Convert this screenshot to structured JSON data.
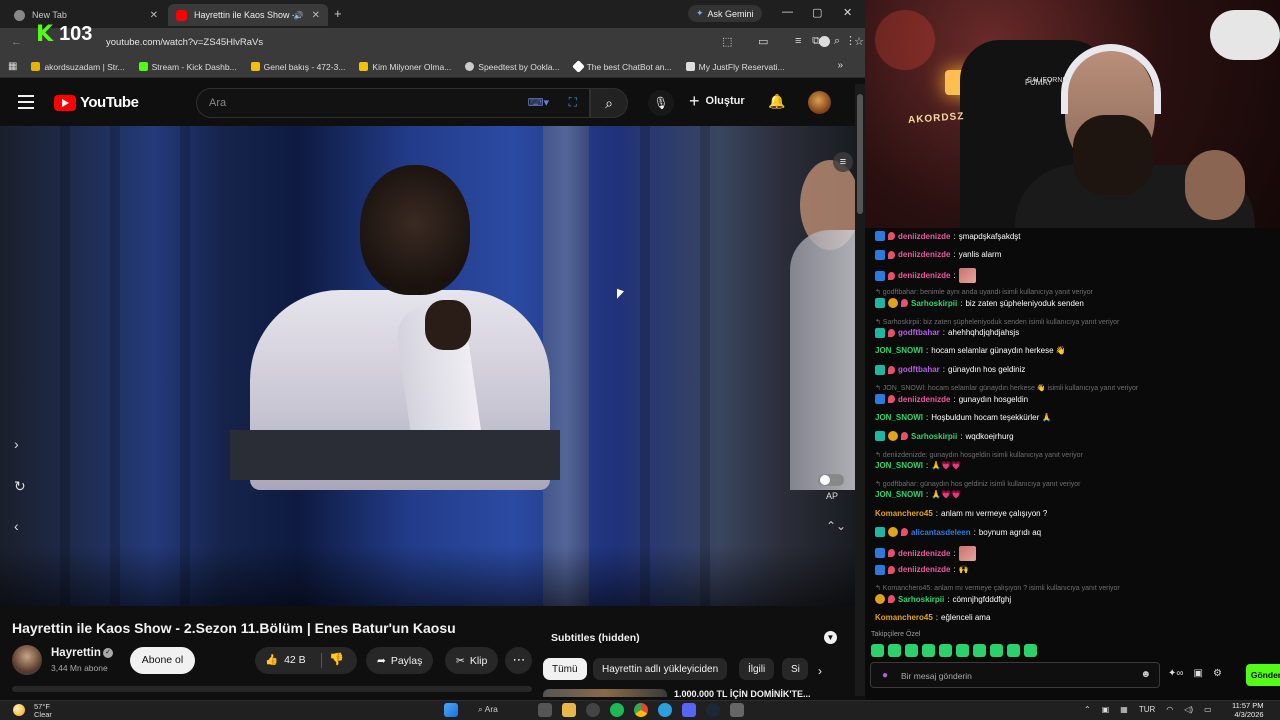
{
  "browser": {
    "tabs": [
      {
        "title": "New Tab"
      },
      {
        "title": "Hayrettin ile Kaos Show - 2..."
      }
    ],
    "ask_gemini": "Ask Gemini",
    "url": "youtube.com/watch?v=ZS45HlvRaVs",
    "bookmarks": [
      {
        "label": "akordsuzadam | Str...",
        "color": "#e6b400"
      },
      {
        "label": "Stream - Kick Dashb...",
        "color": "#53fc18"
      },
      {
        "label": "Genel bakış - 472-3...",
        "color": "#fbbc04"
      },
      {
        "label": "Kim Milyoner Olma...",
        "color": "#f2c200"
      },
      {
        "label": "Speedtest by Ookla...",
        "color": "#cccccc"
      },
      {
        "label": "The best ChatBot an...",
        "color": "#ffffff"
      },
      {
        "label": "My JustFly Reservati...",
        "color": "#dddddd"
      }
    ]
  },
  "kick_overlay": {
    "logo": "K",
    "viewers": "103"
  },
  "youtube": {
    "logo_text": "YouTube",
    "search_placeholder": "Ara",
    "create_label": "Oluştur",
    "video": {
      "title": "Hayrettin ile Kaos Show - 2.Sezon 11.Bölüm | Enes Batur'un Kaosu",
      "autoplay_label": "AP"
    },
    "channel": {
      "name": "Hayrettin",
      "subscribers": "3,44 Mn abone",
      "subscribe_label": "Abone ol"
    },
    "actions": {
      "likes": "42 B",
      "share": "Paylaş",
      "clip": "Klip"
    },
    "subtitles_label": "Subtitles (hidden)",
    "chips": [
      "Tümü",
      "Hayrettin adlı yükleyiciden",
      "İlgili",
      "Si"
    ],
    "recommended_title": "1.000.000 TL İÇİN DOMİNİK'TE..."
  },
  "stream_overlay": {
    "sign_text": "AKORDSZ",
    "small_sign": "CALIFORNIA",
    "headset_text": "FUMAY"
  },
  "chat": {
    "messages": [
      {
        "user": "deniizdenizde",
        "color": "#e85aa0",
        "text": "şmapdşkafşakdşt",
        "badges": [
          "blue",
          "drop"
        ]
      },
      {
        "user": "deniizdenizde",
        "color": "#e85aa0",
        "text": "yanlis alarm",
        "badges": [
          "blue",
          "drop"
        ]
      },
      {
        "user": "deniizdenizde",
        "color": "#e85aa0",
        "text": "",
        "badges": [
          "blue",
          "drop"
        ],
        "emote": true
      },
      {
        "reply": "godftbahar: benimle aynı anda uyandı isimli kullanıcıya yanıt veriyor"
      },
      {
        "user": "Sarhoskirpii",
        "color": "#2dd46e",
        "text": "biz zaten şüpheleniyoduk senden",
        "badges": [
          "teal",
          "gold",
          "drop"
        ]
      },
      {
        "reply": "Sarhoskirpii: biz zaten şüpheleniyoduk senden isimli kullanıcıya yanıt veriyor"
      },
      {
        "user": "godftbahar",
        "color": "#b45ee8",
        "text": "ahehhqhdjqhdjahsjs",
        "badges": [
          "teal",
          "drop"
        ]
      },
      {
        "user": "JON_SNOWl",
        "color": "#2dd46e",
        "text": "hocam selamlar günaydın herkese 👋",
        "badges": []
      },
      {
        "user": "godftbahar",
        "color": "#b45ee8",
        "text": "günaydın hos geldiniz",
        "badges": [
          "teal",
          "drop"
        ]
      },
      {
        "reply": "JON_SNOWl: hocam selamlar günaydın herkese 👋 isimli kullanıcıya yanıt veriyor"
      },
      {
        "user": "deniizdenizde",
        "color": "#e85aa0",
        "text": "gunaydın hosgeldin",
        "badges": [
          "blue",
          "drop"
        ]
      },
      {
        "user": "JON_SNOWl",
        "color": "#2dd46e",
        "text": "Hoşbuldum hocam teşekkürler 🙏",
        "badges": []
      },
      {
        "user": "Sarhoskirpii",
        "color": "#2dd46e",
        "text": "wqdkoeįrhurg",
        "badges": [
          "teal",
          "gold",
          "drop"
        ]
      },
      {
        "reply": "deniizdenizde: gunaydın hosgeldin isimli kullanıcıya yanıt veriyor"
      },
      {
        "user": "JON_SNOWl",
        "color": "#2dd46e",
        "text": "🙏💗💗",
        "badges": []
      },
      {
        "reply": "godftbahar: günaydın hos geldiniz isimli kullanıcıya yanıt veriyor"
      },
      {
        "user": "JON_SNOWl",
        "color": "#2dd46e",
        "text": "🙏💗💗",
        "badges": []
      },
      {
        "user": "Komanchero45",
        "color": "#e0a21a",
        "text": "anlam mı vermeye çalışıyon ?",
        "badges": []
      },
      {
        "user": "alicantasdeleen",
        "color": "#2a7ae0",
        "text": "boynum agrıdı aq",
        "badges": [
          "teal",
          "gold",
          "drop"
        ]
      },
      {
        "user": "deniizdenizde",
        "color": "#e85aa0",
        "text": "",
        "badges": [
          "blue",
          "drop"
        ],
        "emote": true
      },
      {
        "user": "deniizdenizde",
        "color": "#e85aa0",
        "text": "🙌",
        "badges": [
          "blue",
          "drop"
        ]
      },
      {
        "reply": "Komanchero45: anlam mı vermeye çalışıyon ? isimli kullanıcıya yanıt veriyor"
      },
      {
        "user": "Sarhoskirpii",
        "color": "#2dd46e",
        "text": "cömnjhgfdddfghj",
        "badges": [
          "gold",
          "drop"
        ]
      },
      {
        "user": "Komanchero45",
        "color": "#e0a21a",
        "text": "eğlenceli ama",
        "badges": []
      }
    ],
    "followers_only_label": "Takipçilere Özel",
    "input_placeholder": "Bir mesaj gönderin",
    "send_label": "Gönder"
  },
  "taskbar": {
    "weather_temp": "57°F",
    "weather_desc": "Clear",
    "search_label": "Ara",
    "lang": "TUR",
    "time": "11:57 PM",
    "date": "4/3/2026"
  }
}
